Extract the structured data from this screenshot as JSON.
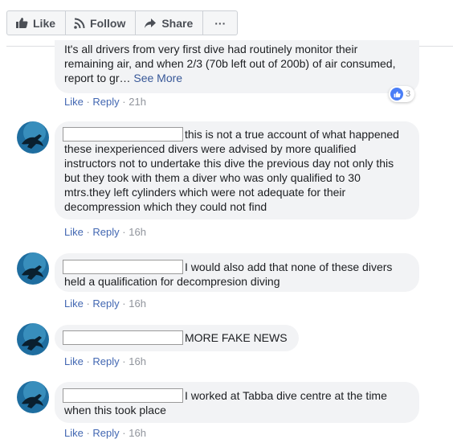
{
  "toolbar": {
    "like_label": "Like",
    "follow_label": "Follow",
    "share_label": "Share",
    "more_label": "···"
  },
  "comments": [
    {
      "text": "It's all drivers from very first dive had routinely monitor their remaining air, and when 2/3 (70b left out of 200b) of air consumed, report to gr…",
      "see_more": "See More",
      "like": "Like",
      "reply": "Reply",
      "time": "21h",
      "reactions": "3"
    },
    {
      "text": "this is not a true account of what happened these inexperienced divers were advised by more qualified instructors not to undertake this dive the previous day not only this but they took with them a diver who was only qualified to 30 mtrs.they left cylinders which were not adequate for their decompression which they could not find",
      "like": "Like",
      "reply": "Reply",
      "time": "16h"
    },
    {
      "text": "I would also add that none of these divers held a qualification for decompresion diving",
      "like": "Like",
      "reply": "Reply",
      "time": "16h"
    },
    {
      "text": "MORE FAKE NEWS",
      "like": "Like",
      "reply": "Reply",
      "time": "16h"
    },
    {
      "text": "I worked at Tabba dive centre at the time when this took place",
      "like": "Like",
      "reply": "Reply",
      "time": "16h"
    }
  ],
  "colors": {
    "link": "#4267b2",
    "meta": "#90949c",
    "bubble": "#f2f3f5",
    "reaction_like": "#4a7ef7"
  }
}
